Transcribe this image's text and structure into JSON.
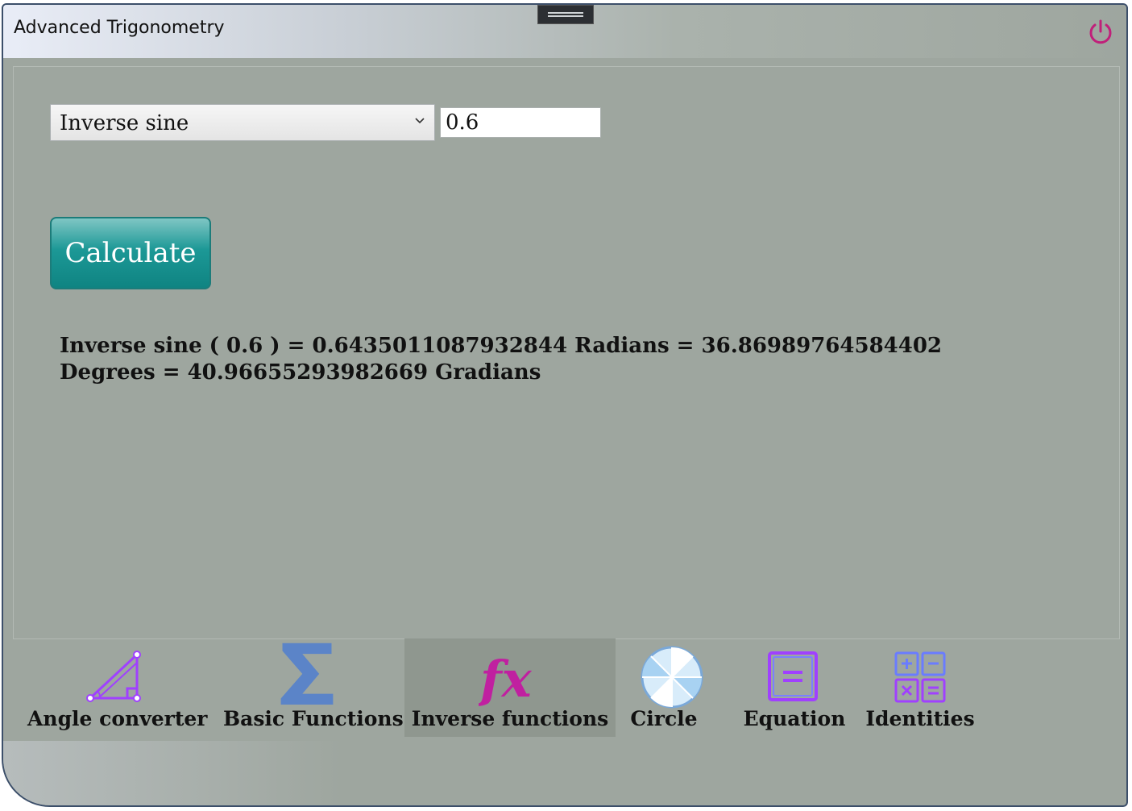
{
  "window": {
    "title": "Advanced Trigonometry"
  },
  "form": {
    "function_selected": "Inverse sine",
    "input_value": "0.6",
    "calculate_label": "Calculate"
  },
  "result": {
    "text": "Inverse sine ( 0.6 ) = 0.6435011087932844 Radians = 36.86989764584402 Degrees = 40.96655293982669 Gradians"
  },
  "nav": {
    "items": [
      {
        "label": "Angle converter",
        "icon": "triangle-icon"
      },
      {
        "label": "Basic Functions",
        "icon": "sigma-icon"
      },
      {
        "label": "Inverse functions",
        "icon": "fx-icon",
        "active": true
      },
      {
        "label": "Circle",
        "icon": "circle-icon"
      },
      {
        "label": "Equation",
        "icon": "equals-icon"
      },
      {
        "label": "Identities",
        "icon": "calculator-icon"
      }
    ]
  },
  "colors": {
    "background": "#9ea69f",
    "accent_teal": "#0f8482",
    "icon_purple": "#a040ff",
    "icon_magenta": "#c020a0",
    "power_icon": "#c0207a"
  }
}
